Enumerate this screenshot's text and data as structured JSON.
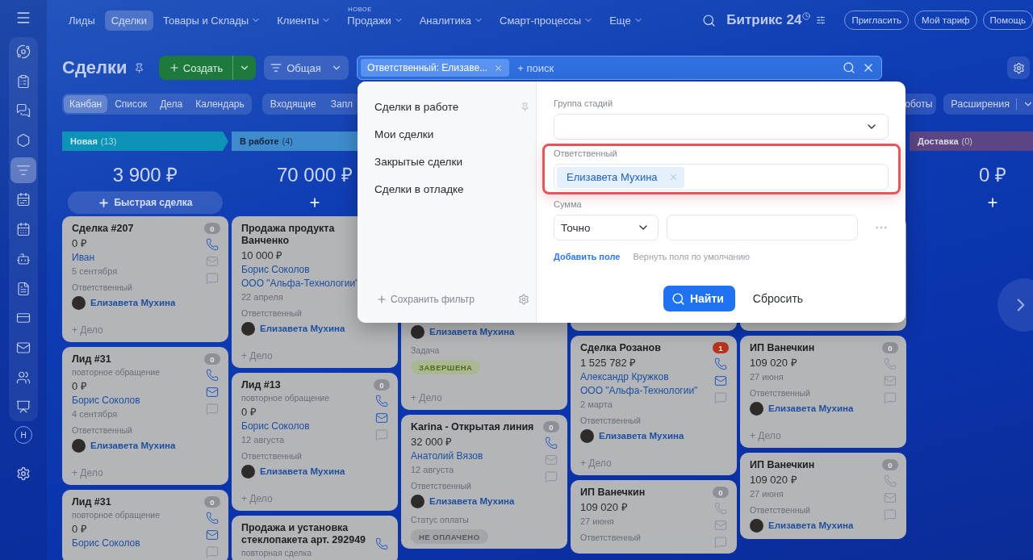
{
  "sidebar": {
    "items": [
      {
        "selected": false
      },
      {
        "selected": false
      },
      {
        "selected": false
      },
      {
        "selected": false
      },
      {
        "selected": true
      },
      {
        "selected": false
      },
      {
        "selected": false
      },
      {
        "selected": false
      },
      {
        "selected": false
      },
      {
        "selected": false
      },
      {
        "selected": false
      },
      {
        "selected": false
      },
      {
        "selected": false
      }
    ],
    "avatar": "Н"
  },
  "top_nav": {
    "items": [
      {
        "label": "Лиды",
        "selected": false,
        "dropdown": false
      },
      {
        "label": "Сделки",
        "selected": true,
        "dropdown": false
      },
      {
        "label": "Товары и Склады",
        "selected": false,
        "dropdown": true
      },
      {
        "label": "Клиенты",
        "selected": false,
        "dropdown": true
      },
      {
        "label": "Продажи",
        "selected": false,
        "dropdown": true,
        "badge": "НОВОЕ"
      },
      {
        "label": "Аналитика",
        "selected": false,
        "dropdown": true
      },
      {
        "label": "Смарт-процессы",
        "selected": false,
        "dropdown": true
      },
      {
        "label": "Еще",
        "selected": false,
        "dropdown": true
      }
    ],
    "logo": "Битрикс 24",
    "buttons": [
      "Пригласить",
      "Мой тариф",
      "Помощь"
    ]
  },
  "title_row": {
    "title": "Сделки",
    "create": "Создать",
    "category": "Общая",
    "search": {
      "chips": [
        "Ответственный: Елизаве..."
      ],
      "placeholder": "+ поиск"
    }
  },
  "view_row": {
    "tabs": [
      {
        "label": "Канбан",
        "selected": true
      },
      {
        "label": "Список",
        "selected": false
      },
      {
        "label": "Дела",
        "selected": false
      },
      {
        "label": "Календарь",
        "selected": false
      }
    ],
    "filters": [
      "Входящие",
      "Запл"
    ],
    "robots": "оботы",
    "extensions": "Расширения"
  },
  "board": {
    "columns": [
      {
        "title": "Новая",
        "count": "(13)",
        "color": "#0e93b8",
        "sum": "3 900 ₽",
        "quick_add": "Быстрая сделка",
        "cards": [
          {
            "kind": "full",
            "title": "Сделка #207",
            "price": "0 ₽",
            "contacts": [
              "Иван"
            ],
            "date": "5 сентября",
            "responsible_label": "Ответственный",
            "responsible": "Елизавета Мухина",
            "add_activity": "+ Дело",
            "badge": "0",
            "badge_alert": false,
            "phone": true,
            "mail": false,
            "chat": false
          },
          {
            "kind": "full",
            "title": "Лид #31",
            "subtitle": "повторное обращение",
            "price": "0 ₽",
            "contacts": [
              "Борис Соколов"
            ],
            "date": "4 сентября",
            "responsible_label": "Ответственный",
            "responsible": "Елизавета Мухина",
            "add_activity": "+ Дело",
            "badge": "0",
            "badge_alert": false,
            "phone": true,
            "mail": true,
            "chat": false
          },
          {
            "kind": "full",
            "title": "Лид #31",
            "subtitle": "повторное обращение",
            "price": "0 ₽",
            "contacts": [
              "Борис Соколов"
            ],
            "badge": "0",
            "badge_alert": false,
            "phone": true,
            "mail": true,
            "chat": false
          }
        ]
      },
      {
        "title": "В работе",
        "count": "(4)",
        "color": "#3e8ccc",
        "sum": "70 000 ₽",
        "cards": [
          {
            "kind": "full",
            "title": "Продажа продукта Ванченко",
            "price": "10 000 ₽",
            "contacts": [
              "Борис Соколов",
              "ООО \"Альфа-Технологии\""
            ],
            "date": "22 апреля",
            "responsible_label": "Ответственный",
            "responsible": "Елизавета Мухина",
            "add_activity": "+ Дело"
          },
          {
            "kind": "full",
            "title": "Лид #13",
            "subtitle": "повторное обращение",
            "price": "0 ₽",
            "contacts": [
              "Борис Соколов"
            ],
            "date": "12 августа",
            "responsible_label": "Ответственный",
            "responsible": "Елизавета Мухина",
            "add_activity": "+ Дело",
            "badge": "0",
            "badge_alert": false,
            "phone": true,
            "mail": true,
            "chat": false
          },
          {
            "kind": "full",
            "title": "Продажа и установка стеклопакета арт. 292949",
            "subtitle": "повторная сделка",
            "phone": true
          }
        ]
      },
      {
        "cards": [
          {
            "kind": "lower",
            "responsible": "Елизавета Мухина",
            "extras": [
              {
                "label": "Задача",
                "tag": "ЗАВЕРШЕНА",
                "kind": "done"
              }
            ],
            "add_activity": "+ Дело"
          },
          {
            "kind": "full",
            "title": "Karina - Открытая линия",
            "price": "32 000 ₽",
            "contacts": [
              "Анатолий Вязов"
            ],
            "date": "12 августа",
            "responsible_label": "Ответственный",
            "responsible": "Елизавета Мухина",
            "extras": [
              {
                "label": "Статус оплаты",
                "tag": "НЕ ОПЛАЧЕНО",
                "kind": "unpaid"
              }
            ],
            "badge": "0",
            "badge_alert": false,
            "phone": true,
            "mail": false,
            "chat": false
          }
        ]
      },
      {
        "cards": [
          {
            "kind": "hidden"
          },
          {
            "kind": "full",
            "title": "Сделка Розанов",
            "price": "1 525 782 ₽",
            "contacts": [
              "Александр Кружков",
              "ООО \"Альфа-Технологии\""
            ],
            "date": "2 марта",
            "responsible_label": "Ответственный",
            "responsible": "Елизавета Мухина",
            "add_activity": "+ Дело",
            "badge": "1",
            "badge_alert": true,
            "phone": true,
            "mail": true,
            "chat": false
          },
          {
            "kind": "full",
            "title": "ИП Ванечкин",
            "price": "109 020 ₽",
            "date": "27 июня",
            "responsible_label": "Ответственный",
            "badge": "0",
            "badge_alert": false,
            "phone": false,
            "mail": false,
            "chat": false
          }
        ]
      },
      {
        "cards": [
          {
            "kind": "hidden"
          },
          {
            "kind": "full",
            "title": "ИП Ванечкин",
            "price": "109 020 ₽",
            "date": "27 июня",
            "responsible_label": "Ответственный",
            "responsible": "Елизавета Мухина",
            "add_activity": "+ Дело",
            "badge": "0",
            "badge_alert": false,
            "phone": false,
            "mail": false,
            "chat": false
          },
          {
            "kind": "full",
            "title": "ИП Ванечкин",
            "price": "109 020 ₽",
            "date": "27 июня",
            "responsible_label": "Ответственный",
            "responsible": "Елизавета Мухина",
            "badge": "0",
            "badge_alert": false,
            "phone": false,
            "mail": false,
            "chat": false
          }
        ]
      },
      {
        "title": "Доставка",
        "count": "(0)",
        "color": "#5c4582",
        "sum": "0 ₽"
      }
    ]
  },
  "filter_popup": {
    "presets": [
      {
        "label": "Сделки в работе",
        "pinned": true
      },
      {
        "label": "Мои сделки",
        "pinned": false
      },
      {
        "label": "Закрытые сделки",
        "pinned": false
      },
      {
        "label": "Сделки в отладке",
        "pinned": false
      }
    ],
    "save_filter": "Сохранить фильтр",
    "fields": [
      {
        "kind": "select",
        "label": "Группа стадий",
        "highlighted": false
      },
      {
        "kind": "people",
        "label": "Ответственный",
        "chips": [
          "Елизавета Мухина"
        ],
        "highlighted": true
      },
      {
        "kind": "number",
        "label": "Сумма",
        "mode": "Точно",
        "highlighted": false
      }
    ],
    "links": [
      {
        "label": "Добавить поле",
        "kind": "primary"
      },
      {
        "label": "Вернуть поля по умолчанию",
        "kind": "muted"
      }
    ],
    "find": "Найти",
    "reset": "Сбросить"
  }
}
